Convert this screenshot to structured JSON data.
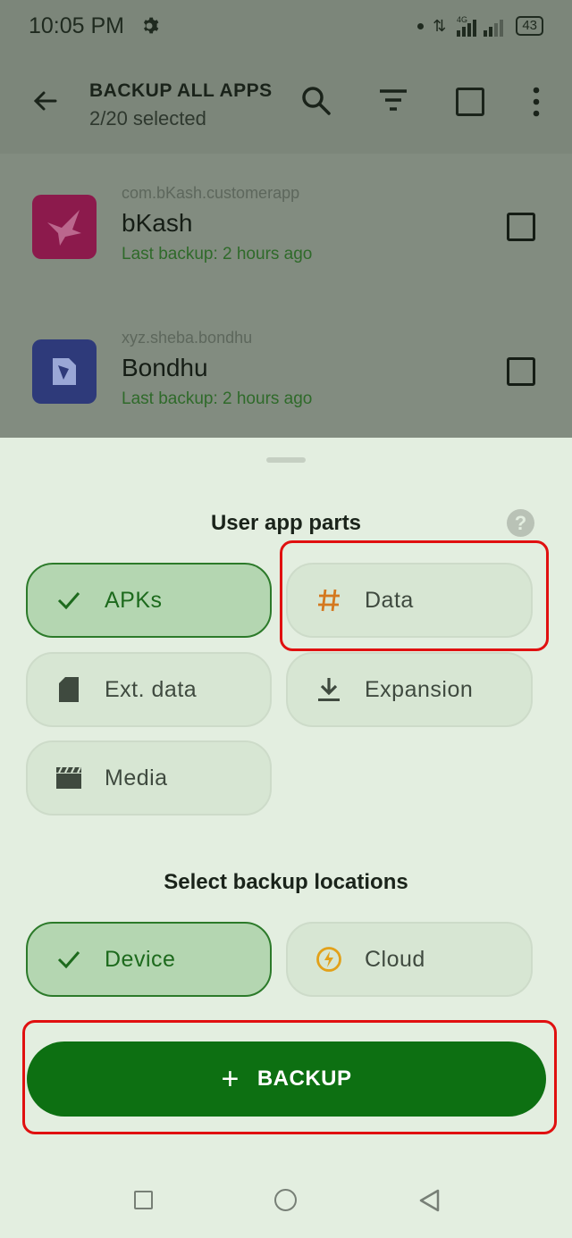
{
  "status_bar": {
    "time": "10:05 PM",
    "network": "4G",
    "battery": "43"
  },
  "app_bar": {
    "title": "BACKUP ALL APPS",
    "subtitle": "2/20 selected"
  },
  "apps": [
    {
      "package": "com.bKash.customerapp",
      "name": "bKash",
      "last_backup": "Last backup: 2 hours ago",
      "icon_color": "#a51054",
      "checked": false
    },
    {
      "package": "xyz.sheba.bondhu",
      "name": "Bondhu",
      "last_backup": "Last backup: 2 hours ago",
      "icon_color": "#2f3b96",
      "checked": false
    }
  ],
  "sheet": {
    "parts_title": "User app parts",
    "help_label": "?",
    "parts": [
      {
        "label": "APKs",
        "icon": "check-icon",
        "selected": true
      },
      {
        "label": "Data",
        "icon": "hash-icon",
        "selected": false
      },
      {
        "label": "Ext. data",
        "icon": "sd-card-icon",
        "selected": false
      },
      {
        "label": "Expansion",
        "icon": "download-icon",
        "selected": false
      },
      {
        "label": "Media",
        "icon": "clapperboard-icon",
        "selected": false
      }
    ],
    "locations_title": "Select backup locations",
    "locations": [
      {
        "label": "Device",
        "icon": "check-icon",
        "selected": true
      },
      {
        "label": "Cloud",
        "icon": "bolt-circle-icon",
        "selected": false
      }
    ],
    "backup_label": "BACKUP",
    "backup_icon": "+"
  },
  "colors": {
    "accent": "#0d7012",
    "highlight": "#e01010",
    "chip_selected": "#b4d6b1"
  }
}
